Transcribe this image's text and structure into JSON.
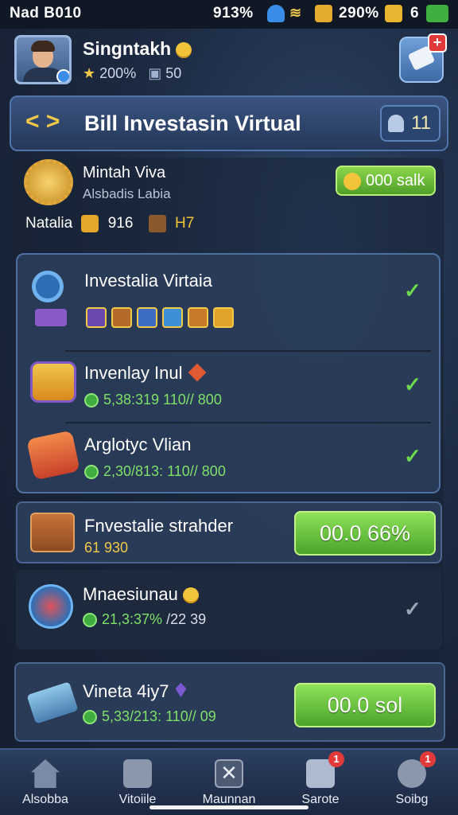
{
  "status_bar": {
    "carrier": "Nad B010",
    "signal": "913%",
    "battery_pct": "290%",
    "battery_num": "6"
  },
  "profile": {
    "name": "Singntakh",
    "stars": "200%",
    "rank": "50"
  },
  "title_bar": {
    "title": "Bill Investasin Virtual",
    "online_count": "11"
  },
  "summary": {
    "title": "Mintah Viva",
    "subtitle": "Alsbadis Labia",
    "salk_label": "000 salk",
    "resource_label": "Natalia",
    "gold": "916",
    "crate": "H7"
  },
  "items": [
    {
      "title": "Investalia Virtaia"
    },
    {
      "title": "Invenlay Inul",
      "amount": "5,38:319",
      "meta": "110// 800"
    },
    {
      "title": "Arglotyc Vlian",
      "amount": "2,30/813:",
      "meta": "110// 800"
    }
  ],
  "offers": [
    {
      "title": "Fnvestalie strahder",
      "amount": "61 930",
      "button": "00.0 66%"
    },
    {
      "title": "Mnaesiunau",
      "amount": "21,3:37%",
      "meta": "/22 39"
    },
    {
      "title": "Vineta 4iy7",
      "amount": "5,33/213:",
      "meta": "110// 09",
      "button": "00.0 sol"
    }
  ],
  "nav": [
    {
      "label": "Alsobba",
      "icon": "home-icon"
    },
    {
      "label": "Vitoiile",
      "icon": "clipboard-icon"
    },
    {
      "label": "Maunnan",
      "icon": "close-icon",
      "badge": ""
    },
    {
      "label": "Sarote",
      "icon": "mail-icon",
      "badge": "1"
    },
    {
      "label": "Soibg",
      "icon": "gear-icon",
      "badge": "1"
    }
  ]
}
